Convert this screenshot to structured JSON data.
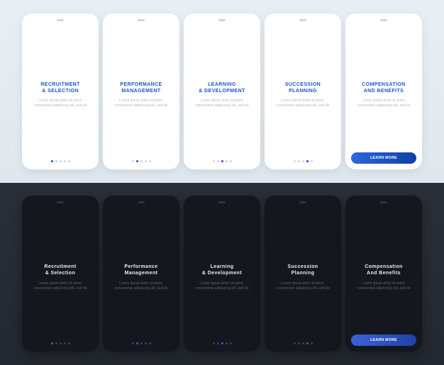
{
  "placeholder_body": "Lorem ipsum dolor sit amet, consectetur adipiscing elit, sed do",
  "cta_label": "LEARN MORE",
  "light": {
    "screens": [
      {
        "title": "RECRUITMENT\n& SELECTION"
      },
      {
        "title": "PERFORMANCE\nMANAGEMENT"
      },
      {
        "title": "LEARNING\n& DEVELOPMENT"
      },
      {
        "title": "SUCCESSION\nPLANNING"
      },
      {
        "title": "COMPENSATION\nAND BENEFITS"
      }
    ]
  },
  "dark": {
    "screens": [
      {
        "title": "Recruitment\n& Selection"
      },
      {
        "title": "Performance\nManagement"
      },
      {
        "title": "Learning\n& Development"
      },
      {
        "title": "Succession\nPlanning"
      },
      {
        "title": "Compensation\nAnd Benefits"
      }
    ]
  }
}
